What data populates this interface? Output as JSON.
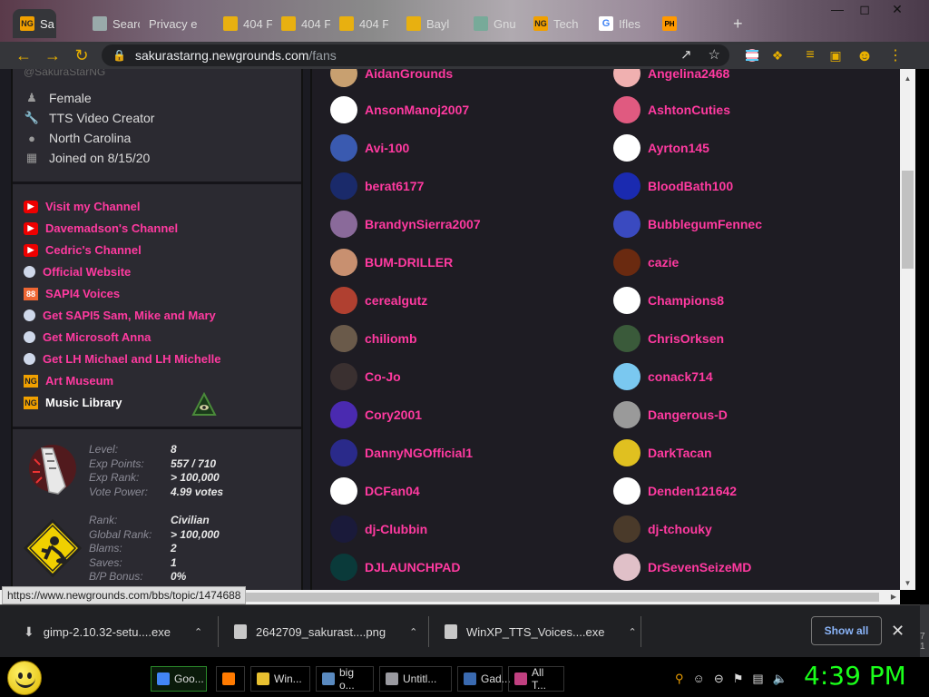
{
  "browser": {
    "tabs": [
      {
        "label": "Sa",
        "icon": "newgrounds-icon",
        "active": true
      },
      {
        "label": "Searc",
        "icon": "page-icon"
      },
      {
        "label": "Privacy e",
        "icon": "page-icon"
      },
      {
        "label": "404 F",
        "icon": "404-icon"
      },
      {
        "label": "404 F",
        "icon": "404-icon"
      },
      {
        "label": "404 F",
        "icon": "404-icon"
      },
      {
        "label": "Bayl",
        "icon": "404-icon"
      },
      {
        "label": "Gnu",
        "icon": "page-icon"
      },
      {
        "label": "Tech",
        "icon": "newgrounds-icon"
      },
      {
        "label": "Ifles",
        "icon": "google-icon"
      },
      {
        "label": "PH",
        "icon": "ph-icon"
      }
    ],
    "new_tab": "+",
    "url_host": "sakurastarng.newgrounds.com",
    "url_path": "/fans",
    "status_url": "https://www.newgrounds.com/bbs/topic/1474688"
  },
  "profile": {
    "handle": "@SakuraStarNG",
    "info": [
      {
        "icon": "person-icon",
        "text": "Female"
      },
      {
        "icon": "wrench-icon",
        "text": "TTS Video Creator"
      },
      {
        "icon": "location-pin-icon",
        "text": "North Carolina"
      },
      {
        "icon": "calendar-icon",
        "text": "Joined on 8/15/20"
      }
    ],
    "links": [
      {
        "icon": "youtube-icon",
        "text": "Visit my Channel"
      },
      {
        "icon": "youtube-icon",
        "text": "Davemadson's Channel"
      },
      {
        "icon": "youtube-icon",
        "text": "Cedric's Channel"
      },
      {
        "icon": "globe-icon",
        "text": "Official Website"
      },
      {
        "icon": "sapi4-icon",
        "icon_text": "88",
        "text": "SAPI4 Voices"
      },
      {
        "icon": "globe-icon",
        "text": "Get SAPI5 Sam, Mike and Mary"
      },
      {
        "icon": "globe-icon",
        "text": "Get Microsoft Anna"
      },
      {
        "icon": "globe-icon",
        "text": "Get LH Michael and LH Michelle"
      },
      {
        "icon": "newgrounds-icon",
        "icon_text": "NG",
        "text": "Art Museum"
      },
      {
        "icon": "newgrounds-icon",
        "icon_text": "NG",
        "text": "Music Library"
      }
    ],
    "stats1": {
      "labels": [
        "Level:",
        "Exp Points:",
        "Exp Rank:",
        "Vote Power:"
      ],
      "values": [
        "8",
        "557 / 710",
        "> 100,000",
        "4.99 votes"
      ]
    },
    "stats2": {
      "labels": [
        "Rank:",
        "Global Rank:",
        "Blams:",
        "Saves:",
        "B/P Bonus:"
      ],
      "values": [
        "Civilian",
        "> 100,000",
        "2",
        "1",
        "0%"
      ]
    }
  },
  "fans": {
    "top_partial": [
      "AidanGrounds",
      "Angelina2468"
    ],
    "left": [
      {
        "name": "AnsonManoj2007",
        "color": "#ffffff"
      },
      {
        "name": "Avi-100",
        "color": "#3a5ab0"
      },
      {
        "name": "berat6177",
        "color": "#1a2a6a"
      },
      {
        "name": "BrandynSierra2007",
        "color": "#8a6a9a"
      },
      {
        "name": "BUM-DRILLER",
        "color": "#c89070"
      },
      {
        "name": "cerealgutz",
        "color": "#b04030"
      },
      {
        "name": "chiliomb",
        "color": "#6a5a4a"
      },
      {
        "name": "Co-Jo",
        "color": "#3a3030"
      },
      {
        "name": "Cory2001",
        "color": "#4a2ab0"
      },
      {
        "name": "DannyNGOfficial1",
        "color": "#2a2a8a"
      },
      {
        "name": "DCFan04",
        "color": "#ffffff"
      },
      {
        "name": "dj-Clubbin",
        "color": "#1a1a3a"
      },
      {
        "name": "DJLAUNCHPAD",
        "color": "#0a3a3a"
      }
    ],
    "right": [
      {
        "name": "AshtonCuties",
        "color": "#e05a80"
      },
      {
        "name": "Ayrton145",
        "color": "#ffffff"
      },
      {
        "name": "BloodBath100",
        "color": "#1a2ab0"
      },
      {
        "name": "BubblegumFennec",
        "color": "#3a4ac0"
      },
      {
        "name": "cazie",
        "color": "#6a2a10"
      },
      {
        "name": "Champions8",
        "color": "#ffffff"
      },
      {
        "name": "ChrisOrksen",
        "color": "#3a5a3a"
      },
      {
        "name": "conack714",
        "color": "#7ac8f0"
      },
      {
        "name": "Dangerous-D",
        "color": "#9a9a9a"
      },
      {
        "name": "DarkTacan",
        "color": "#e0c020"
      },
      {
        "name": "Denden121642",
        "color": "#ffffff"
      },
      {
        "name": "dj-tchouky",
        "color": "#4a3a2a"
      },
      {
        "name": "DrSevenSeizeMD",
        "color": "#e0c0c8"
      }
    ]
  },
  "downloads": {
    "items": [
      {
        "name": "gimp-2.10.32-setu....exe"
      },
      {
        "name": "2642709_sakurast....png"
      },
      {
        "name": "WinXP_TTS_Voices....exe"
      }
    ],
    "show_all": "Show all",
    "close": "✕",
    "edge_chars": "7 1"
  },
  "taskbar": {
    "buttons": [
      {
        "label": "Goo...",
        "color": "#4285f4",
        "active": true
      },
      {
        "label": "",
        "color": "#ff7a00"
      },
      {
        "label": "Win...",
        "color": "#e8c030"
      },
      {
        "label": "big o...",
        "color": "#5a8ac0"
      },
      {
        "label": "Untitl...",
        "color": "#9a9aa0"
      },
      {
        "label": "Gad...",
        "color": "#3a6ab0"
      },
      {
        "label": "All T...",
        "color": "#c04080"
      }
    ],
    "clock": "4:39 PM"
  },
  "colors": {
    "link": "#ff3aa0",
    "clock": "#1aff1a"
  }
}
